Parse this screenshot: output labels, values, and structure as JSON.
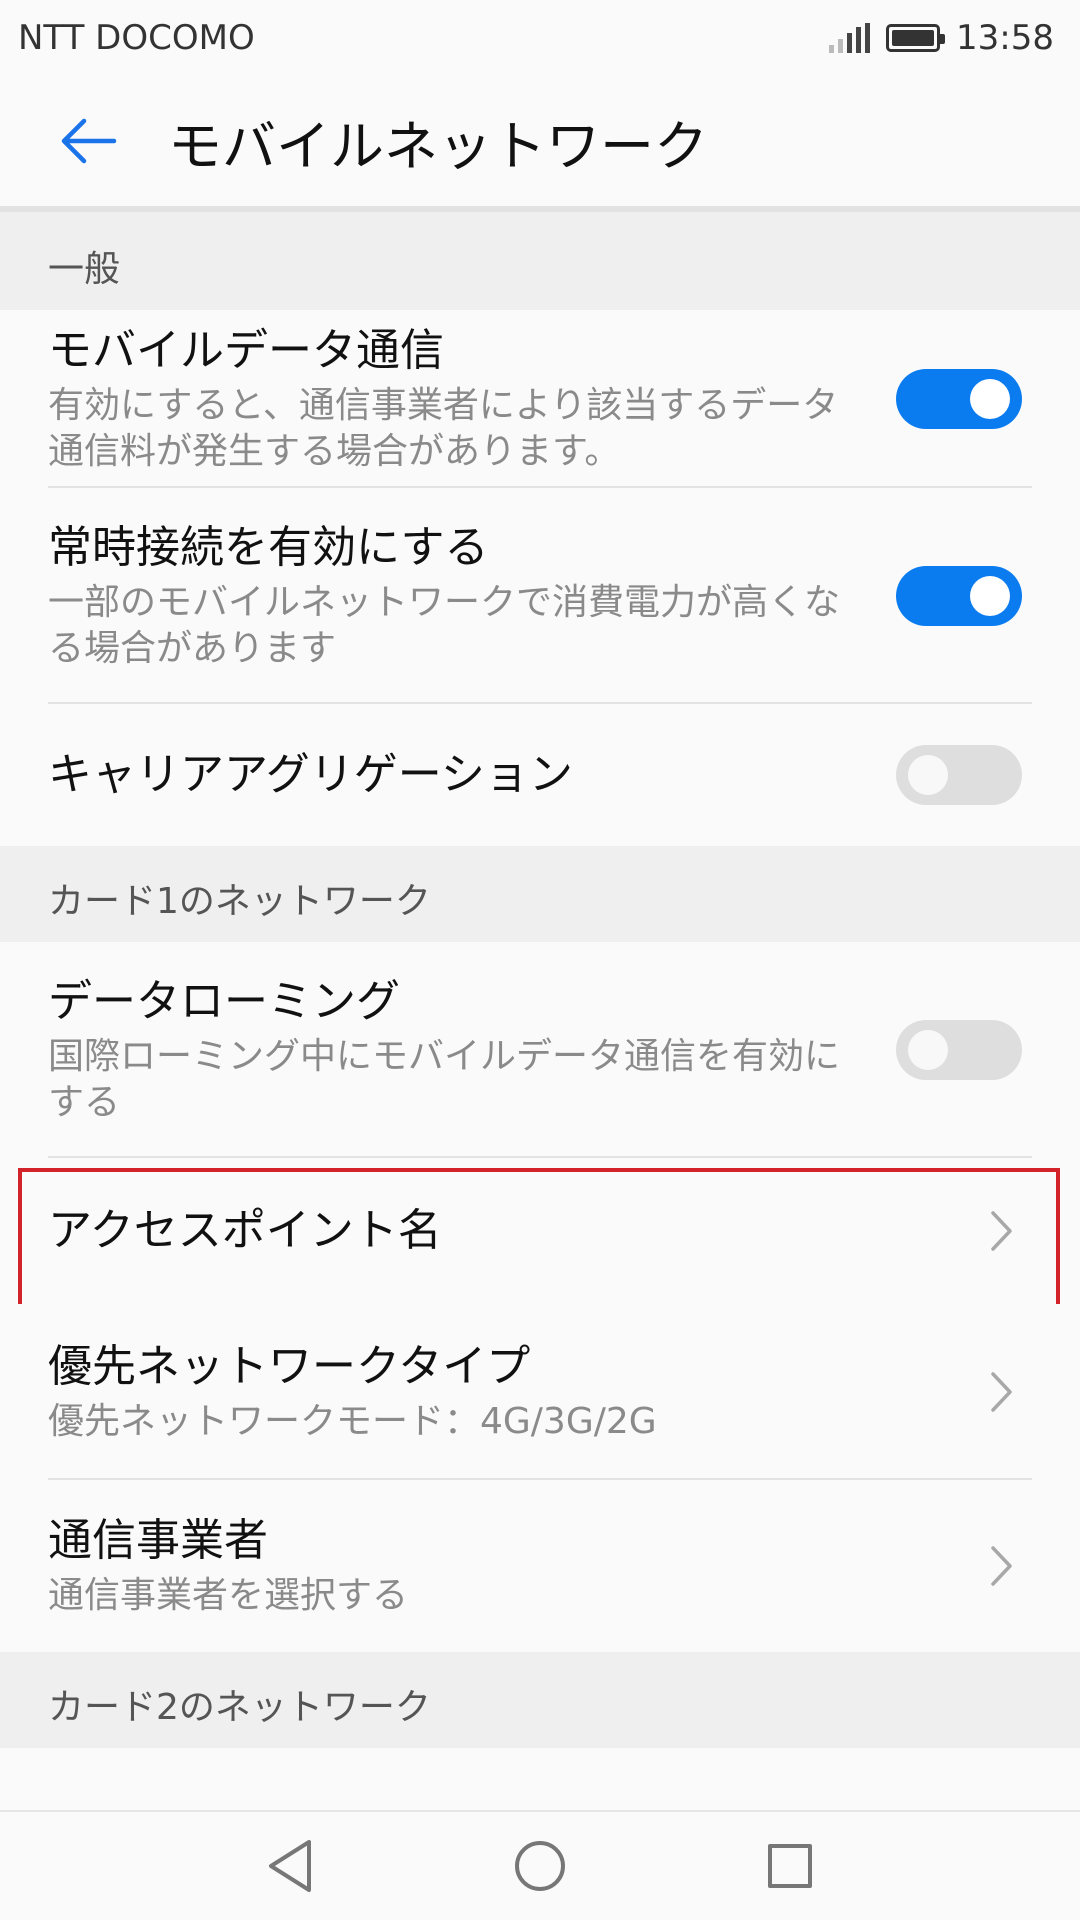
{
  "status_bar": {
    "carrier": "NTT DOCOMO",
    "time": "13:58"
  },
  "app_bar": {
    "title": "モバイルネットワーク"
  },
  "sections": {
    "general": {
      "header": "一般",
      "mobile_data": {
        "title": "モバイルデータ通信",
        "subtitle": "有効にすると、通信事業者により該当するデータ通信料が発生する場合があります。",
        "enabled": true
      },
      "always_on": {
        "title": "常時接続を有効にする",
        "subtitle": "一部のモバイルネットワークで消費電力が高くなる場合があります",
        "enabled": true
      },
      "carrier_agg": {
        "title": "キャリアアグリゲーション",
        "enabled": false
      }
    },
    "card1": {
      "header": "カード1のネットワーク",
      "roaming": {
        "title": "データローミング",
        "subtitle": "国際ローミング中にモバイルデータ通信を有効にする",
        "enabled": false
      },
      "apn": {
        "title": "アクセスポイント名"
      },
      "preferred_type": {
        "title": "優先ネットワークタイプ",
        "subtitle": "優先ネットワークモード：4G/3G/2G"
      },
      "operator": {
        "title": "通信事業者",
        "subtitle": "通信事業者を選択する"
      }
    },
    "card2": {
      "header": "カード2のネットワーク"
    }
  },
  "colors": {
    "accent": "#0a7cf0",
    "highlight": "#d2232a"
  },
  "icons": {
    "back": "arrow-left-icon",
    "chevron": "chevron-right-icon",
    "nav_back": "triangle-back-icon",
    "nav_home": "circle-home-icon",
    "nav_recent": "square-recents-icon"
  }
}
